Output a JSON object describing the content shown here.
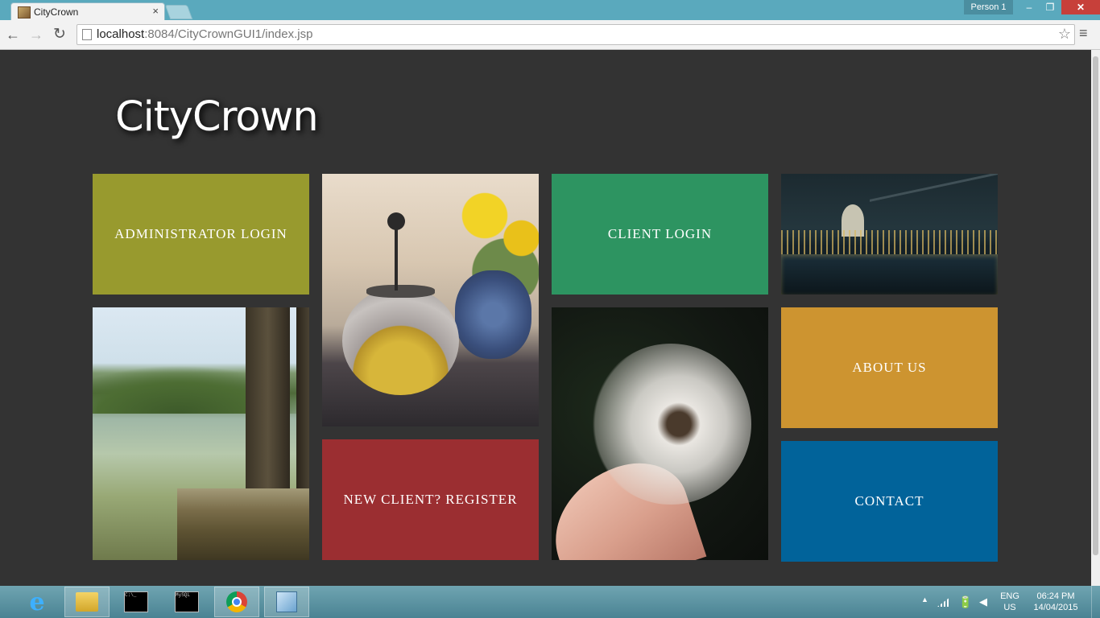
{
  "browser": {
    "tab_title": "CityCrown",
    "tab_close": "×",
    "profile_label": "Person 1",
    "url_host": "localhost",
    "url_rest": ":8084/CityCrownGUI1/index.jsp",
    "back_icon": "←",
    "forward_icon": "→",
    "reload_icon": "↻",
    "star_icon": "☆",
    "menu_icon": "≡",
    "win_min": "–",
    "win_restore": "❐",
    "win_close": "✕"
  },
  "site": {
    "logo": "CityCrown",
    "tiles": {
      "admin": "Administrator Login",
      "client": "Client Login",
      "about": "About Us",
      "contact": "Contact",
      "register": "New Client? Register"
    },
    "colors": {
      "admin": "#989a2e",
      "client": "#2d9461",
      "about": "#cd9430",
      "contact": "#01639a",
      "register": "#9b2e31",
      "background": "#333333"
    }
  },
  "taskbar": {
    "ie_glyph": "e",
    "cmd_text": "C:\\_",
    "mysql_text": "MySQL",
    "tray_up": "▲",
    "power_icon": "🔋",
    "volume_icon": "◀",
    "lang_line1": "ENG",
    "lang_line2": "US",
    "time": "06:24 PM",
    "date": "14/04/2015"
  }
}
